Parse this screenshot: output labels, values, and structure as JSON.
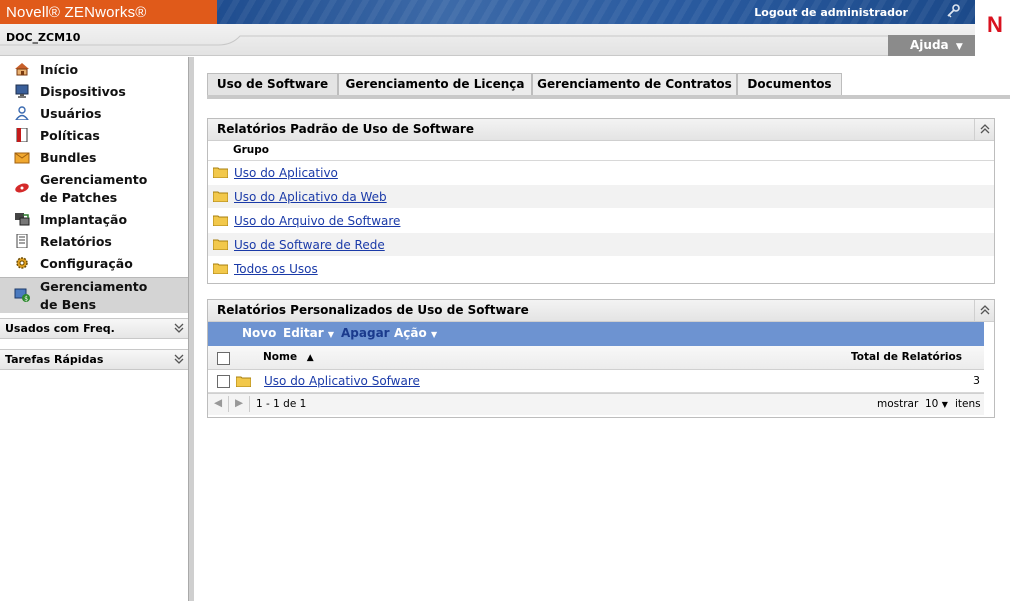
{
  "header": {
    "brand": "Novell® ZENworks®",
    "logout": "Logout de administrador",
    "zone_name": "DOC_ZCM10",
    "help": "Ajuda",
    "logo_letter": "N"
  },
  "sidebar": {
    "items": [
      {
        "label": "Início",
        "icon": "home-icon"
      },
      {
        "label": "Dispositivos",
        "icon": "monitor-icon"
      },
      {
        "label": "Usuários",
        "icon": "user-icon"
      },
      {
        "label": "Políticas",
        "icon": "policy-icon"
      },
      {
        "label": "Bundles",
        "icon": "bundle-icon"
      },
      {
        "label": "Gerenciamento de Patches",
        "icon": "patch-icon"
      },
      {
        "label": "Implantação",
        "icon": "deploy-icon"
      },
      {
        "label": "Relatórios",
        "icon": "report-icon"
      },
      {
        "label": "Configuração",
        "icon": "gear-icon"
      },
      {
        "label": "Gerenciamento de Bens",
        "icon": "asset-icon",
        "active": true
      }
    ],
    "sections": [
      "Usados com Freq.",
      "Tarefas Rápidas"
    ]
  },
  "tabs": [
    "Uso de Software",
    "Gerenciamento de Licença",
    "Gerenciamento de Contratos",
    "Documentos"
  ],
  "standard_reports": {
    "title": "Relatórios Padrão de Uso de Software",
    "column": "Grupo",
    "rows": [
      "Uso do Aplicativo",
      "Uso do Aplicativo da Web",
      "Uso do Arquivo de Software",
      "Uso de Software de Rede",
      "Todos os Usos"
    ]
  },
  "custom_reports": {
    "title": "Relatórios Personalizados de Uso de Software",
    "toolbar": {
      "new": "Novo",
      "edit": "Editar",
      "delete": "Apagar",
      "action": "Ação"
    },
    "columns": {
      "name": "Nome",
      "total": "Total de Relatórios"
    },
    "rows": [
      {
        "name": "Uso do Aplicativo Sofware",
        "total": "3"
      }
    ],
    "pager": {
      "range": "1 - 1 de 1",
      "show": "mostrar",
      "count": "10",
      "items": "itens"
    }
  }
}
